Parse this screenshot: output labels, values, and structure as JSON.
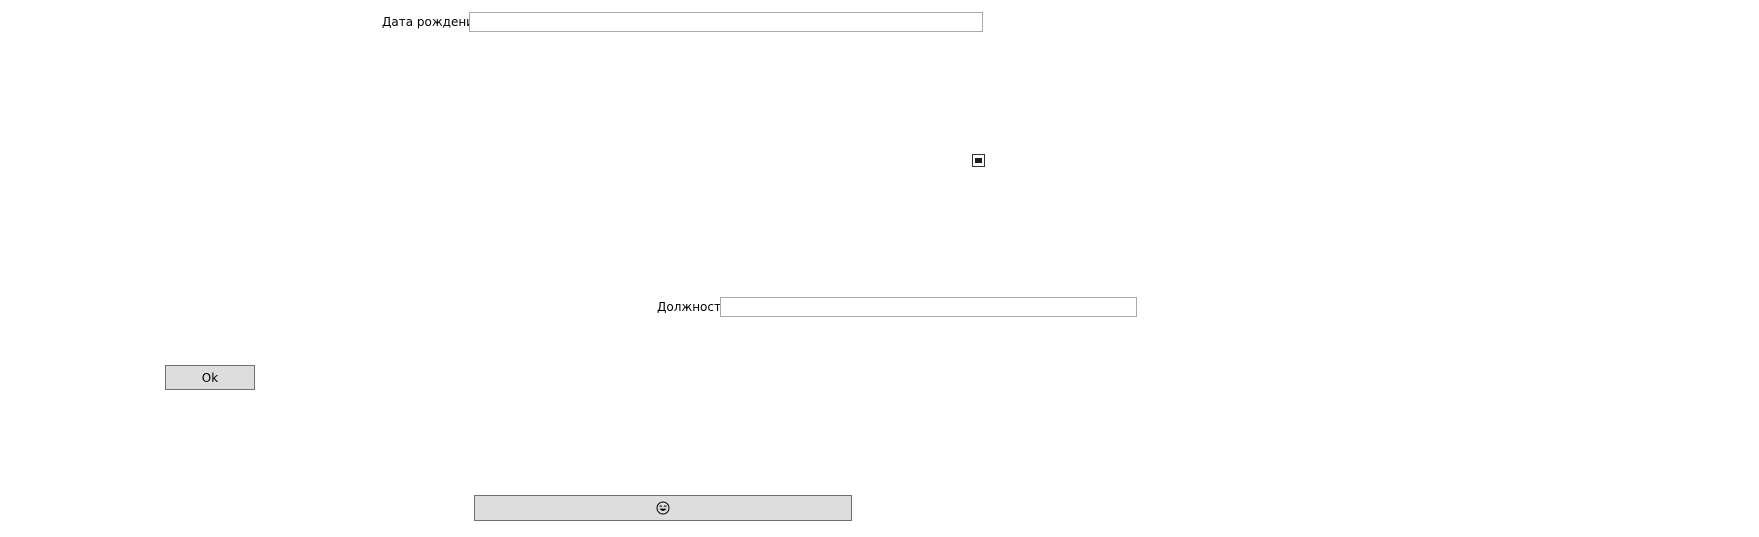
{
  "form": {
    "birthdate_label": "Дата рождения",
    "birthdate_value": "",
    "position_label": "Должность",
    "position_value": "",
    "checkbox_checked": true,
    "ok_label": "Ok",
    "emoji_button_icon": "smiling-face-icon"
  }
}
